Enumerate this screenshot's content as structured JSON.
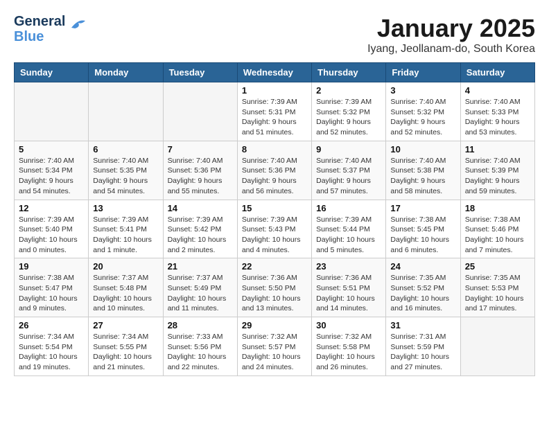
{
  "header": {
    "logo_line1": "General",
    "logo_line2": "Blue",
    "title": "January 2025",
    "subtitle": "Iyang, Jeollanam-do, South Korea"
  },
  "weekdays": [
    "Sunday",
    "Monday",
    "Tuesday",
    "Wednesday",
    "Thursday",
    "Friday",
    "Saturday"
  ],
  "weeks": [
    [
      {
        "day": "",
        "info": ""
      },
      {
        "day": "",
        "info": ""
      },
      {
        "day": "",
        "info": ""
      },
      {
        "day": "1",
        "info": "Sunrise: 7:39 AM\nSunset: 5:31 PM\nDaylight: 9 hours\nand 51 minutes."
      },
      {
        "day": "2",
        "info": "Sunrise: 7:39 AM\nSunset: 5:32 PM\nDaylight: 9 hours\nand 52 minutes."
      },
      {
        "day": "3",
        "info": "Sunrise: 7:40 AM\nSunset: 5:32 PM\nDaylight: 9 hours\nand 52 minutes."
      },
      {
        "day": "4",
        "info": "Sunrise: 7:40 AM\nSunset: 5:33 PM\nDaylight: 9 hours\nand 53 minutes."
      }
    ],
    [
      {
        "day": "5",
        "info": "Sunrise: 7:40 AM\nSunset: 5:34 PM\nDaylight: 9 hours\nand 54 minutes."
      },
      {
        "day": "6",
        "info": "Sunrise: 7:40 AM\nSunset: 5:35 PM\nDaylight: 9 hours\nand 54 minutes."
      },
      {
        "day": "7",
        "info": "Sunrise: 7:40 AM\nSunset: 5:36 PM\nDaylight: 9 hours\nand 55 minutes."
      },
      {
        "day": "8",
        "info": "Sunrise: 7:40 AM\nSunset: 5:36 PM\nDaylight: 9 hours\nand 56 minutes."
      },
      {
        "day": "9",
        "info": "Sunrise: 7:40 AM\nSunset: 5:37 PM\nDaylight: 9 hours\nand 57 minutes."
      },
      {
        "day": "10",
        "info": "Sunrise: 7:40 AM\nSunset: 5:38 PM\nDaylight: 9 hours\nand 58 minutes."
      },
      {
        "day": "11",
        "info": "Sunrise: 7:40 AM\nSunset: 5:39 PM\nDaylight: 9 hours\nand 59 minutes."
      }
    ],
    [
      {
        "day": "12",
        "info": "Sunrise: 7:39 AM\nSunset: 5:40 PM\nDaylight: 10 hours\nand 0 minutes."
      },
      {
        "day": "13",
        "info": "Sunrise: 7:39 AM\nSunset: 5:41 PM\nDaylight: 10 hours\nand 1 minute."
      },
      {
        "day": "14",
        "info": "Sunrise: 7:39 AM\nSunset: 5:42 PM\nDaylight: 10 hours\nand 2 minutes."
      },
      {
        "day": "15",
        "info": "Sunrise: 7:39 AM\nSunset: 5:43 PM\nDaylight: 10 hours\nand 4 minutes."
      },
      {
        "day": "16",
        "info": "Sunrise: 7:39 AM\nSunset: 5:44 PM\nDaylight: 10 hours\nand 5 minutes."
      },
      {
        "day": "17",
        "info": "Sunrise: 7:38 AM\nSunset: 5:45 PM\nDaylight: 10 hours\nand 6 minutes."
      },
      {
        "day": "18",
        "info": "Sunrise: 7:38 AM\nSunset: 5:46 PM\nDaylight: 10 hours\nand 7 minutes."
      }
    ],
    [
      {
        "day": "19",
        "info": "Sunrise: 7:38 AM\nSunset: 5:47 PM\nDaylight: 10 hours\nand 9 minutes."
      },
      {
        "day": "20",
        "info": "Sunrise: 7:37 AM\nSunset: 5:48 PM\nDaylight: 10 hours\nand 10 minutes."
      },
      {
        "day": "21",
        "info": "Sunrise: 7:37 AM\nSunset: 5:49 PM\nDaylight: 10 hours\nand 11 minutes."
      },
      {
        "day": "22",
        "info": "Sunrise: 7:36 AM\nSunset: 5:50 PM\nDaylight: 10 hours\nand 13 minutes."
      },
      {
        "day": "23",
        "info": "Sunrise: 7:36 AM\nSunset: 5:51 PM\nDaylight: 10 hours\nand 14 minutes."
      },
      {
        "day": "24",
        "info": "Sunrise: 7:35 AM\nSunset: 5:52 PM\nDaylight: 10 hours\nand 16 minutes."
      },
      {
        "day": "25",
        "info": "Sunrise: 7:35 AM\nSunset: 5:53 PM\nDaylight: 10 hours\nand 17 minutes."
      }
    ],
    [
      {
        "day": "26",
        "info": "Sunrise: 7:34 AM\nSunset: 5:54 PM\nDaylight: 10 hours\nand 19 minutes."
      },
      {
        "day": "27",
        "info": "Sunrise: 7:34 AM\nSunset: 5:55 PM\nDaylight: 10 hours\nand 21 minutes."
      },
      {
        "day": "28",
        "info": "Sunrise: 7:33 AM\nSunset: 5:56 PM\nDaylight: 10 hours\nand 22 minutes."
      },
      {
        "day": "29",
        "info": "Sunrise: 7:32 AM\nSunset: 5:57 PM\nDaylight: 10 hours\nand 24 minutes."
      },
      {
        "day": "30",
        "info": "Sunrise: 7:32 AM\nSunset: 5:58 PM\nDaylight: 10 hours\nand 26 minutes."
      },
      {
        "day": "31",
        "info": "Sunrise: 7:31 AM\nSunset: 5:59 PM\nDaylight: 10 hours\nand 27 minutes."
      },
      {
        "day": "",
        "info": ""
      }
    ]
  ]
}
